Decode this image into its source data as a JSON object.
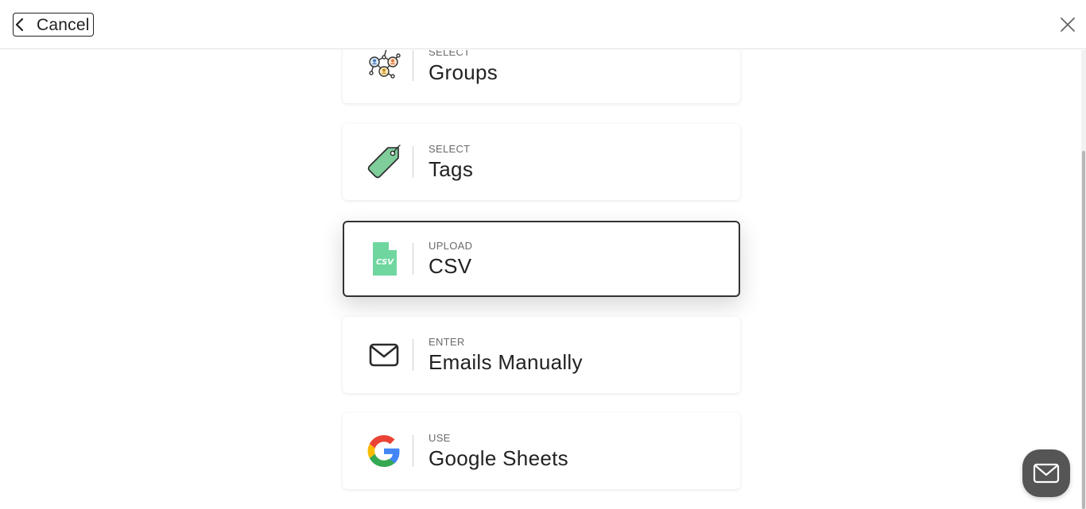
{
  "header": {
    "cancel_label": "Cancel",
    "close_icon": "close-icon",
    "back_icon": "chevron-left-icon"
  },
  "options": [
    {
      "action": "SELECT",
      "label": "Groups",
      "icon": "groups-network-icon",
      "selected": false
    },
    {
      "action": "SELECT",
      "label": "Tags",
      "icon": "tag-icon",
      "selected": false
    },
    {
      "action": "UPLOAD",
      "label": "CSV",
      "icon": "csv-file-icon",
      "selected": true
    },
    {
      "action": "ENTER",
      "label": "Emails Manually",
      "icon": "envelope-icon",
      "selected": false
    },
    {
      "action": "USE",
      "label": "Google Sheets",
      "icon": "google-icon",
      "selected": false
    }
  ],
  "chat": {
    "icon": "mail-icon"
  },
  "colors": {
    "accent_green": "#6fd6a0",
    "tag_green": "#7fcd9b",
    "border_selected": "#333333",
    "launcher": "#555555"
  }
}
